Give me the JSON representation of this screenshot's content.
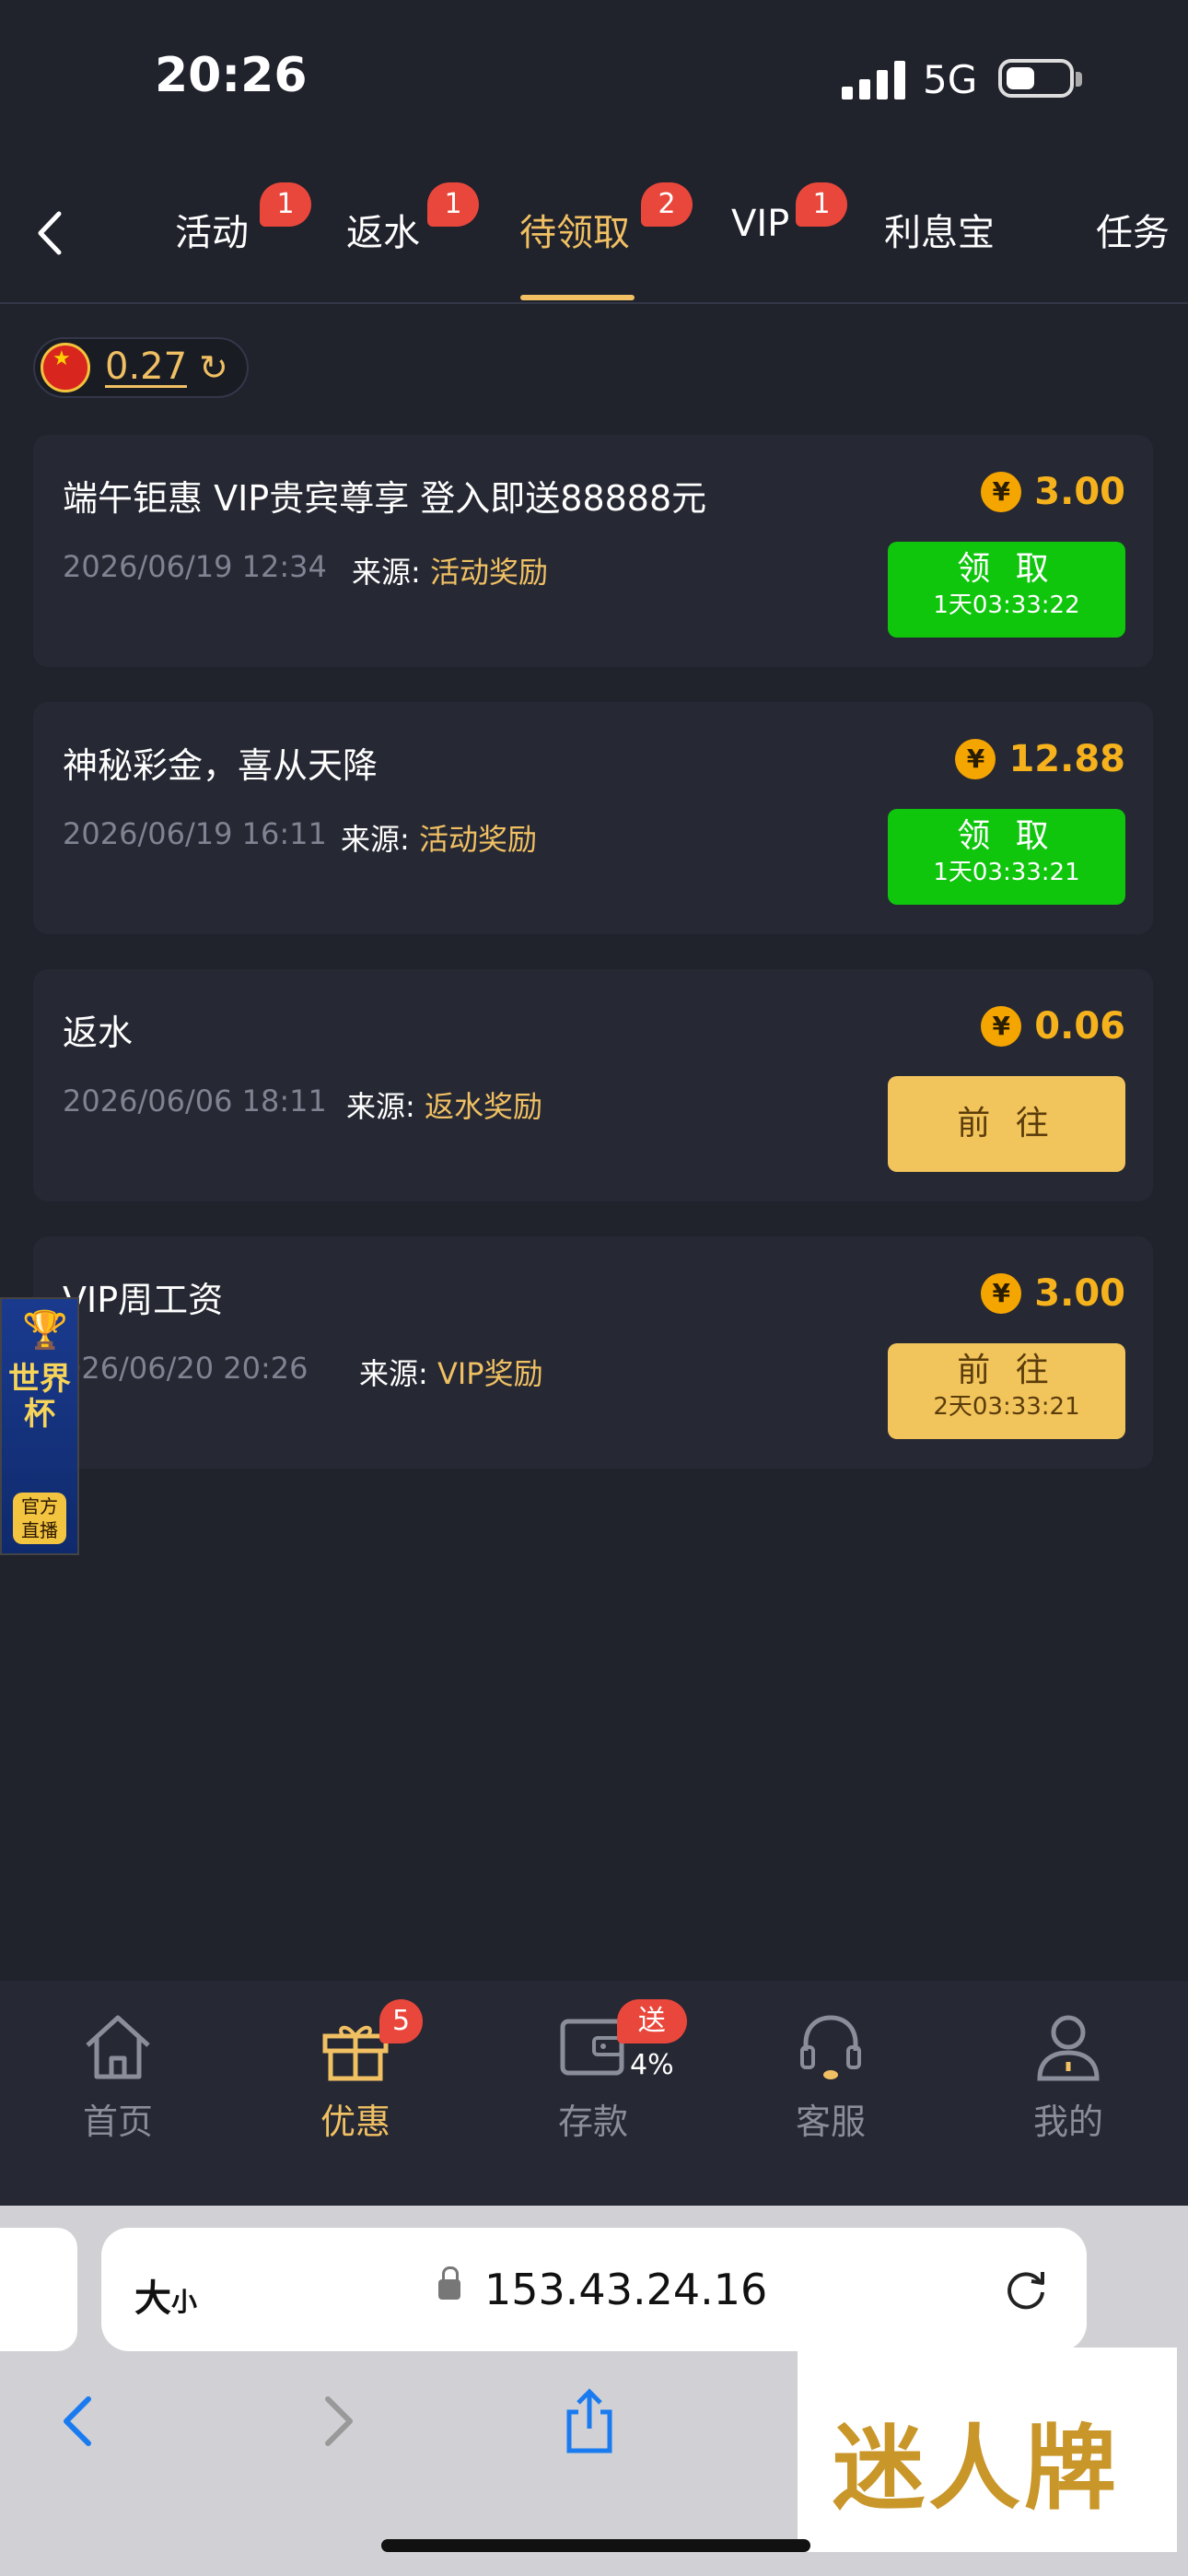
{
  "status": {
    "time": "20:26",
    "network": "5G"
  },
  "tabs": [
    {
      "label": "活动",
      "badge": "1"
    },
    {
      "label": "返水",
      "badge": "1"
    },
    {
      "label": "待领取",
      "badge": "2",
      "active": true
    },
    {
      "label": "VIP",
      "badge": "1"
    },
    {
      "label": "利息宝",
      "badge": ""
    },
    {
      "label": "任务",
      "badge": ""
    }
  ],
  "balance": {
    "value": "0.27",
    "currency_icon": "china-flag-icon"
  },
  "source_label": "来源:",
  "rewards": [
    {
      "title": "端午钜惠 VIP贵宾尊享 登入即送88888元",
      "date": "2026/06/19 12:34",
      "source": "活动奖励",
      "amount": "3.00",
      "button": "领 取",
      "timer": "1天03:33:22",
      "button_style": "green"
    },
    {
      "title": "神秘彩金，喜从天降",
      "date": "2026/06/19 16:11",
      "source": "活动奖励",
      "amount": "12.88",
      "button": "领 取",
      "timer": "1天03:33:21",
      "button_style": "green"
    },
    {
      "title": "返水",
      "date": "2026/06/06 18:11",
      "source": "返水奖励",
      "amount": "0.06",
      "button": "前 往",
      "timer": "",
      "button_style": "gold"
    },
    {
      "title": "VIP周工资",
      "date": "026/06/20 20:26",
      "source": "VIP奖励",
      "amount": "3.00",
      "button": "前 往",
      "timer": "2天03:33:21",
      "button_style": "gold"
    }
  ],
  "float_banner": {
    "title": "世界杯",
    "subtitle": "官方直播"
  },
  "bottom_nav": [
    {
      "label": "首页",
      "icon": "home-icon",
      "badge": ""
    },
    {
      "label": "优惠",
      "icon": "gift-icon",
      "badge": "5",
      "active": true
    },
    {
      "label": "存款",
      "icon": "wallet-icon",
      "badge": "送4%"
    },
    {
      "label": "客服",
      "icon": "headset-icon",
      "badge": ""
    },
    {
      "label": "我的",
      "icon": "user-icon",
      "badge": ""
    }
  ],
  "browser": {
    "aa_big": "大",
    "aa_small": "小",
    "url": "153.43.24.16"
  },
  "watermark": "迷人牌",
  "colors": {
    "accent": "#f0c063",
    "green": "#0fc60d",
    "badge": "#e9473b",
    "bg": "#20222c",
    "card": "#262833"
  }
}
